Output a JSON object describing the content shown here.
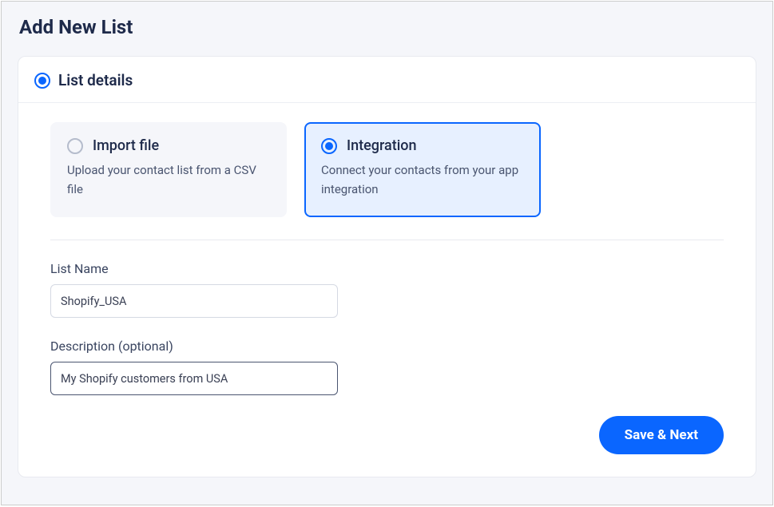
{
  "page": {
    "title": "Add New List"
  },
  "section": {
    "title": "List details"
  },
  "options": {
    "import": {
      "title": "Import file",
      "desc": "Upload your contact list from a CSV file"
    },
    "integration": {
      "title": "Integration",
      "desc": "Connect your contacts from your app integration"
    }
  },
  "form": {
    "list_name_label": "List Name",
    "list_name_value": "Shopify_USA",
    "description_label": "Description (optional)",
    "description_value": "My Shopify customers from USA"
  },
  "actions": {
    "save_next": "Save & Next"
  }
}
